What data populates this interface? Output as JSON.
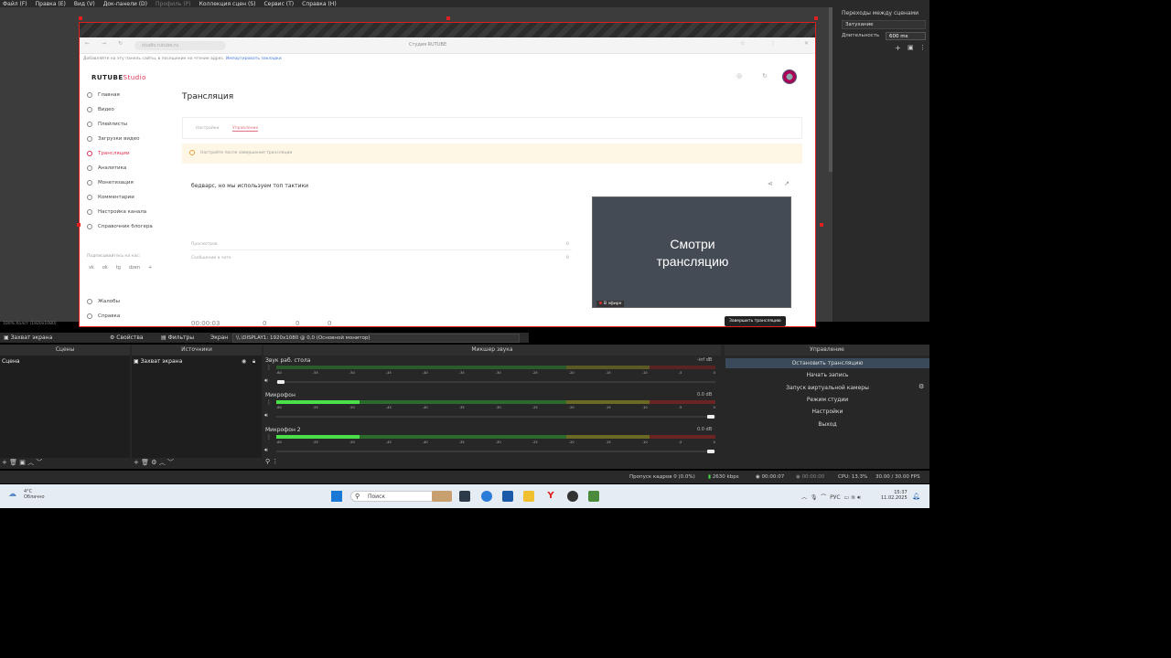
{
  "menu": [
    "Файл (F)",
    "Правка (E)",
    "Вид (V)",
    "Док-панели (D)",
    "Профиль (P)",
    "Коллекция сцен (S)",
    "Сервис (T)",
    "Справка (H)"
  ],
  "browser": {
    "url": "studio.rutube.ru",
    "tab_title": "Студия RUTUBE",
    "hint": "Добавляйте на эту панель сайты, в посещение на чтение адрес.",
    "hint_link": "Импортировать закладки"
  },
  "studio": {
    "logo": "RUTUBE",
    "logo_suffix": "Studio",
    "sidebar": [
      "Главная",
      "Видео",
      "Плейлисты",
      "Загрузки видео",
      "Трансляции",
      "Аналитика",
      "Монетизация",
      "Комментарии",
      "Настройка канала",
      "Справочник блогера"
    ],
    "social_label": "Подписывайтесь на нас:",
    "social_icons": [
      "vk",
      "ok",
      "tg",
      "dzen",
      "+"
    ],
    "bottom_links": [
      "Жалобы",
      "Справка"
    ],
    "page_title": "Трансляция",
    "tabs": [
      "Настройки",
      "Управление"
    ],
    "alert": "Настройте после завершения трансляции",
    "stream_title": "бедварс, но мы используем топ тактики",
    "stats": [
      {
        "label": "Просмотров",
        "value": "0"
      },
      {
        "label": "Сообщений в чате",
        "value": "0"
      }
    ],
    "thumbnail_text": "Смотри\nтрансляцию",
    "live_badge": "В эфире",
    "end_button": "Завершить трансляцию",
    "timer": "00:00:03",
    "counters": [
      "0",
      "0",
      "0"
    ]
  },
  "preview_status": "100% Холст (1920x1080)",
  "transitions": {
    "title": "Переходы между сценами",
    "type": "Затухание",
    "duration_label": "Длительность",
    "duration": "600 ms"
  },
  "toolbar": {
    "source": "Захват экрана",
    "properties": "Свойства",
    "filters": "Фильтры",
    "screen_label": "Экран",
    "screen_value": "\\\\.\\DISPLAY1: 1920x1080 @ 0,0 (Основной монитор)"
  },
  "docks": {
    "scenes": "Сцены",
    "sources": "Источники",
    "mixer": "Микшер звука",
    "controls": "Управление"
  },
  "scenes": [
    "Сцена"
  ],
  "sources": [
    "Захват экрана"
  ],
  "mixer": {
    "scale": [
      "-60",
      "-55",
      "-50",
      "-45",
      "-40",
      "-35",
      "-30",
      "-25",
      "-20",
      "-15",
      "-10",
      "-5",
      "0"
    ],
    "tracks": [
      {
        "name": "Звук раб. стола",
        "db": "-inf dB",
        "level": 0,
        "fader": 0.01
      },
      {
        "name": "Микрофон",
        "db": "0.0 dB",
        "level": 0.19,
        "fader": 0.99
      },
      {
        "name": "Микрофон 2",
        "db": "0.0 dB",
        "level": 0.19,
        "fader": 0.99
      }
    ]
  },
  "controls": [
    "Остановить трансляцию",
    "Начать запись",
    "Запуск виртуальной камеры",
    "Режим студии",
    "Настройки",
    "Выход"
  ],
  "status": {
    "dropped": "Пропуск кадров 0 (0.0%)",
    "bitrate": "2630 kbps",
    "live_time": "00:00:07",
    "rec_time": "00:00:00",
    "cpu": "CPU: 13.3%",
    "fps": "30.00 / 30.00 FPS"
  },
  "taskbar": {
    "weather_temp": "4°C",
    "weather_desc": "Облачно",
    "search": "Поиск",
    "lang": "РУС",
    "time": "15:37",
    "date": "11.02.2025"
  }
}
